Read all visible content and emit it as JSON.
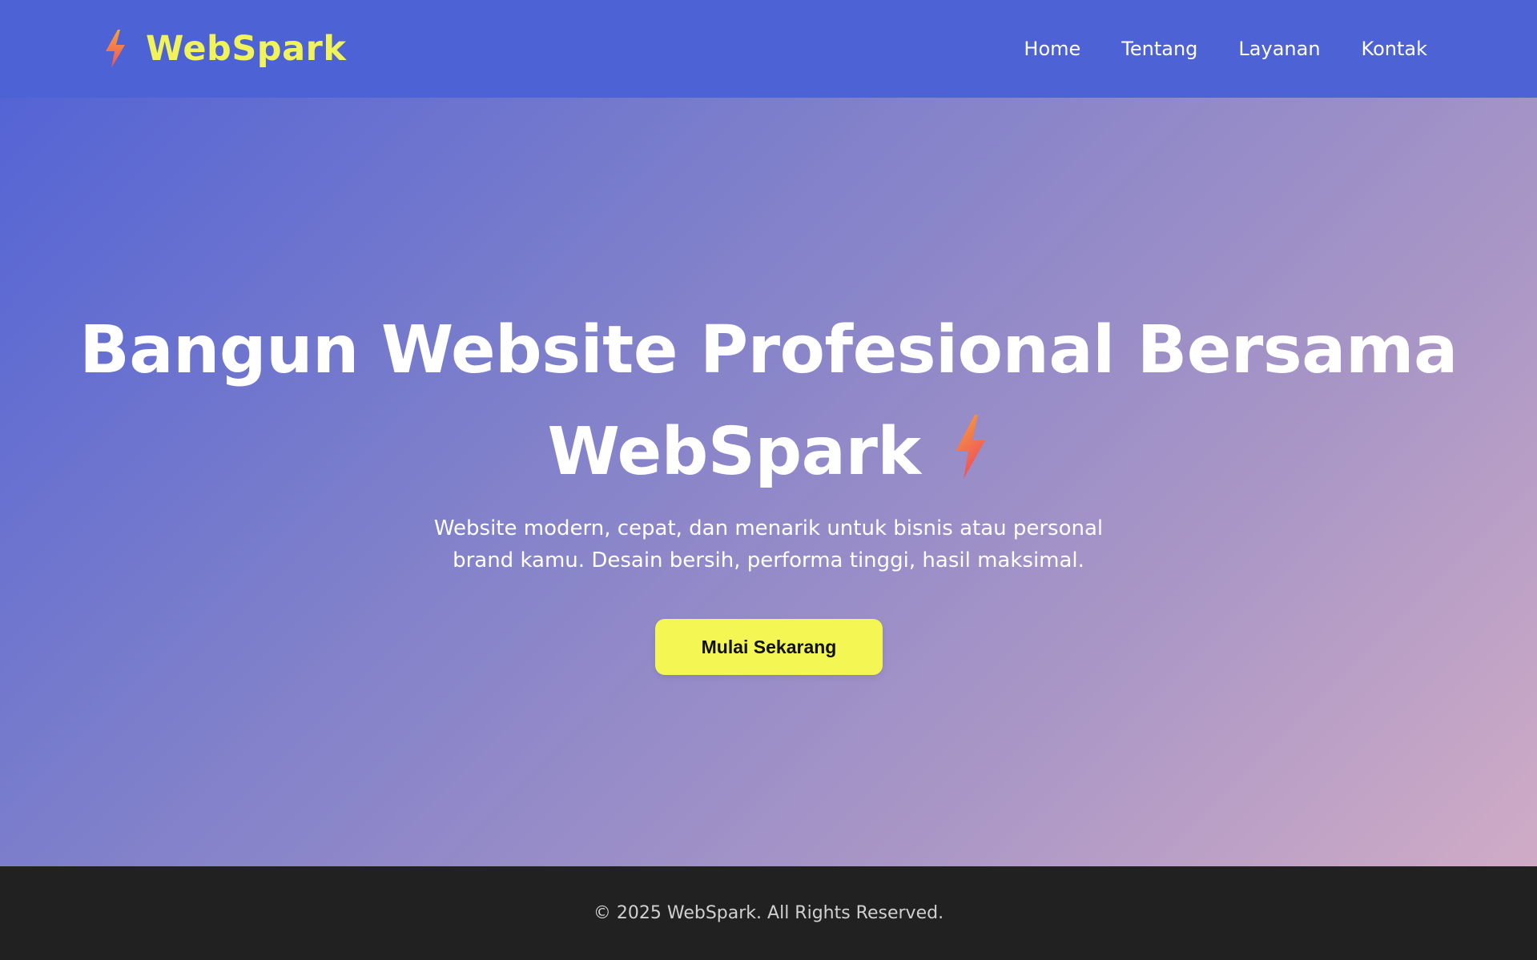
{
  "navbar": {
    "brand": {
      "name": "WebSpark",
      "icon": "lightning-bolt-icon"
    },
    "links": [
      {
        "label": "Home"
      },
      {
        "label": "Tentang"
      },
      {
        "label": "Layanan"
      },
      {
        "label": "Kontak"
      }
    ]
  },
  "hero": {
    "title_line1": "Bangun Website Profesional Bersama",
    "title_line2": "WebSpark",
    "title_icon": "lightning-bolt-icon",
    "subtitle_line1": "Website modern, cepat, dan menarik untuk bisnis atau personal",
    "subtitle_line2": "brand kamu. Desain bersih, performa tinggi, hasil maksimal.",
    "cta_label": "Mulai Sekarang"
  },
  "footer": {
    "text": "© 2025 WebSpark. All Rights Reserved."
  },
  "colors": {
    "navbar_bg": "#4c62d5",
    "brand_text": "#f1f35a",
    "cta_bg": "#f4f653",
    "footer_bg": "#212121",
    "gradient_start": "#4f61d6",
    "gradient_end": "#d5aec6",
    "bolt_top": "#f6a23a",
    "bolt_bottom": "#ef4f5d"
  }
}
